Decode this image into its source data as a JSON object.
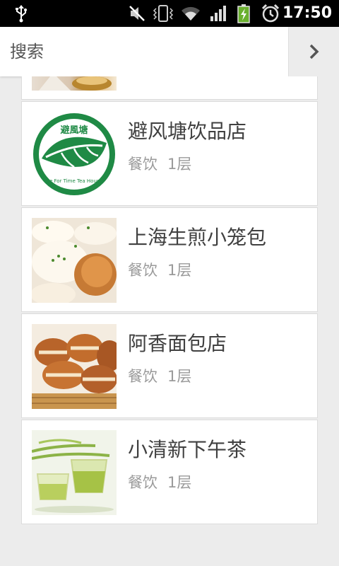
{
  "status_bar": {
    "time": "17:50",
    "icons": [
      "usb-icon",
      "mute-icon",
      "vibrate-icon",
      "wifi-icon",
      "signal-icon",
      "battery-charging-icon",
      "alarm-icon"
    ]
  },
  "search": {
    "placeholder": "搜索",
    "go_icon": "chevron-right-icon"
  },
  "stores": [
    {
      "name": "",
      "category": "",
      "floor": ""
    },
    {
      "name": "避风塘饮品店",
      "category": "餐饮",
      "floor": "1层",
      "logo_text": "Be For Time Tea House"
    },
    {
      "name": "上海生煎小笼包",
      "category": "餐饮",
      "floor": "1层"
    },
    {
      "name": "阿香面包店",
      "category": "餐饮",
      "floor": "1层"
    },
    {
      "name": "小清新下午茶",
      "category": "餐饮",
      "floor": "1层"
    }
  ],
  "colors": {
    "background": "#ececec",
    "title_text": "#404040",
    "meta_text": "#9a9a9a",
    "logo_green": "#1f8a45"
  }
}
